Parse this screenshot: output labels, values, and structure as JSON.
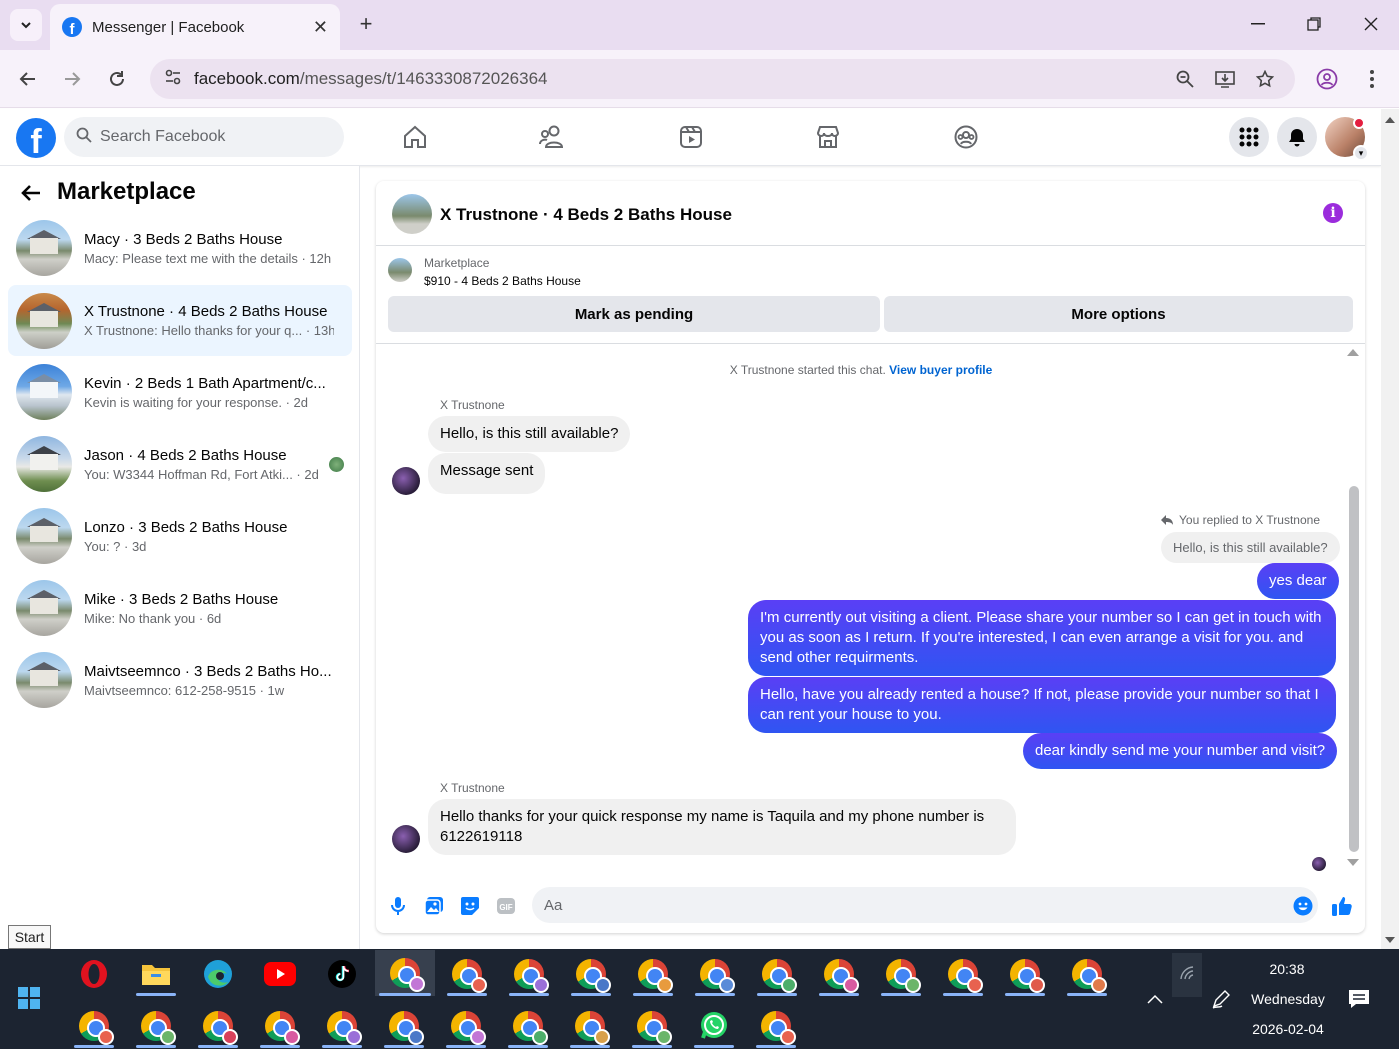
{
  "browser": {
    "tab_title": "Messenger | Facebook",
    "url_host": "facebook.com",
    "url_path": "/messages/t/1463330872026364"
  },
  "facebook": {
    "search_placeholder": "Search Facebook"
  },
  "sidebar": {
    "title": "Marketplace",
    "conversations": [
      {
        "title": "Macy · 3 Beds 2 Baths House",
        "preview": "Macy: Please text me with the details · 12h",
        "active": false
      },
      {
        "title": "X Trustnone · 4 Beds 2 Baths House",
        "preview": "X Trustnone: Hello thanks for your q... · 13h",
        "active": true
      },
      {
        "title": "Kevin · 2 Beds 1 Bath Apartment/c...",
        "preview": "Kevin is waiting for your response. · 2d",
        "active": false
      },
      {
        "title": "Jason · 4 Beds 2 Baths House",
        "preview": "You: W3344 Hoffman Rd, Fort Atki... · 2d",
        "active": false
      },
      {
        "title": "Lonzo · 3 Beds 2 Baths House",
        "preview": "You: ? · 3d",
        "active": false
      },
      {
        "title": "Mike · 3 Beds 2 Baths House",
        "preview": "Mike: No thank you · 6d",
        "active": false
      },
      {
        "title": "Maivtseemnco · 3 Beds 2 Baths Ho...",
        "preview": "Maivtseemnco: 612-258-9515 · 1w",
        "active": false
      }
    ]
  },
  "chat": {
    "title": "X Trustnone · 4 Beds 2 Baths House",
    "marketplace_label": "Marketplace",
    "listing": "$910 - 4 Beds 2 Baths House",
    "mark_pending": "Mark as pending",
    "more_options": "More options",
    "system_text": "X Trustnone started this chat.",
    "system_link": "View buyer profile",
    "sender_name": "X Trustnone",
    "msg_in_1": "Hello, is this still available?",
    "msg_in_2": "Message sent",
    "replied_label": "You replied to X Trustnone",
    "replied_quote": "Hello, is this still available?",
    "msg_out_1": "yes dear",
    "msg_out_2": "I'm currently out visiting a client. Please share your number so I can get in touch with you as soon as I return. If you're interested, I can even arrange a visit for you. and send other requirments.",
    "msg_out_3": "Hello, have you already rented a house? If not, please provide your number so that I can rent your house to you.",
    "msg_out_4": "dear kindly send me your number and visit?",
    "sender_name_2": "X Trustnone",
    "msg_in_3": "Hello thanks for your quick response my name is Taquila and my phone number is 6122619118",
    "composer_placeholder": "Aa"
  },
  "taskbar": {
    "start_tooltip": "Start",
    "time": "20:38",
    "day": "Wednesday",
    "date": "2026-02-04"
  },
  "colors": {
    "fb_blue": "#1877f2",
    "outgoing_bubble": "#4842f4",
    "active_conv": "#ebf5ff"
  }
}
